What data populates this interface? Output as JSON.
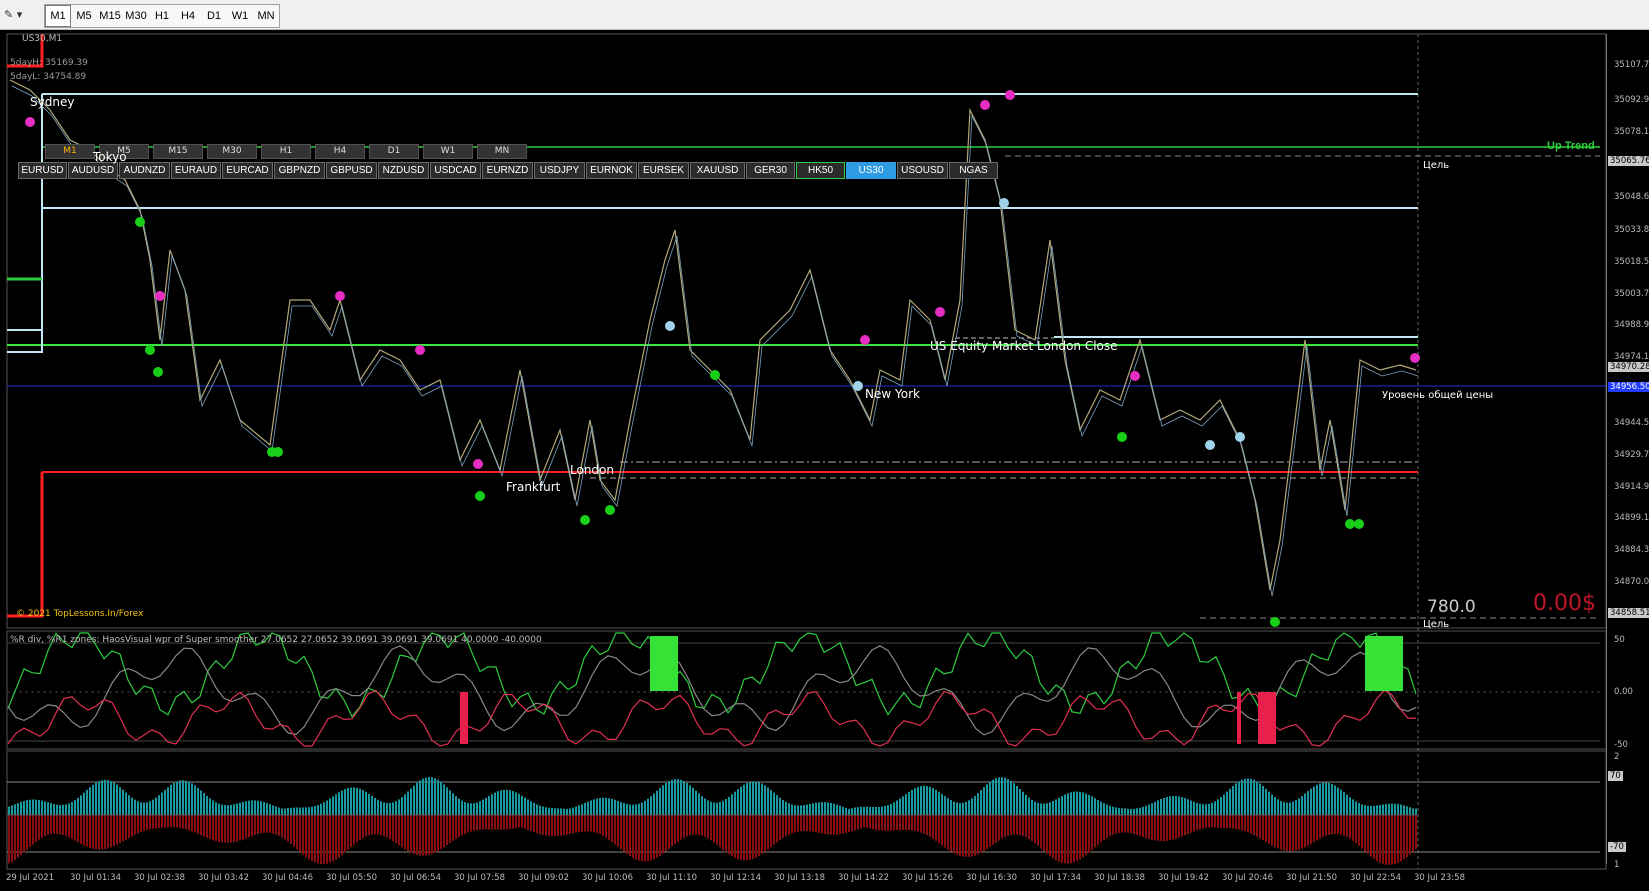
{
  "toolbar": {
    "timeframes": [
      "M1",
      "M5",
      "M15",
      "M30",
      "H1",
      "H4",
      "D1",
      "W1",
      "MN"
    ],
    "active": "M1"
  },
  "chart": {
    "title": "US30,M1",
    "info1": "5dayH: 35169.39",
    "info2": "5dayL: 34754.89",
    "copyright": "© 2021 TopLessons.In/Forex",
    "mini_timeframes": [
      "M1",
      "M5",
      "M15",
      "M30",
      "H1",
      "H4",
      "D1",
      "W1",
      "MN"
    ],
    "mini_active": "M1",
    "symbols": [
      "EURUSD",
      "AUDUSD",
      "AUDNZD",
      "EURAUD",
      "EURCAD",
      "GBPNZD",
      "GBPUSD",
      "NZDUSD",
      "USDCAD",
      "EURNZD",
      "USDJPY",
      "EURNOK",
      "EURSEK",
      "XAUUSD",
      "GER30",
      "HK50",
      "US30",
      "USOUSD",
      "NGAS"
    ],
    "selected_symbol": "US30",
    "highlighted_symbol": "HK50",
    "sessions": {
      "sydney": "Sydney",
      "tokyo": "Tokyo",
      "frankfurt": "Frankfurt",
      "london": "London",
      "new_york": "New York",
      "us_equity": "US Equity Market London Close"
    },
    "up_trend": "Up Trend",
    "target_top": "Цель",
    "target_bottom": "Цель",
    "common_level": "Уровень общей цены",
    "big_value": "780.0",
    "profit": "0.00$"
  },
  "price_axis": {
    "ticks": [
      "35107.70",
      "35092.90",
      "35078.10",
      "35065.76",
      "35048.60",
      "35033.80",
      "35018.50",
      "35003.70",
      "34988.90",
      "34974.10",
      "34970.28",
      "34959.30",
      "34944.50",
      "34929.70",
      "34914.90",
      "34899.10",
      "34884.30",
      "34870.00",
      "34858.51"
    ],
    "current": "34970.28",
    "current_blue": "34956.50"
  },
  "oscillator": {
    "label": "%R div, %R1 zones:  HaosVisual wpr of Super smoother 27.0652 27.0652 39.0691 39.0691 39.0691 40.0000 -40.0000",
    "ticks": [
      "50",
      "0.00",
      "-50"
    ]
  },
  "histogram": {
    "ticks": [
      "2",
      "70",
      "-70",
      "1"
    ]
  },
  "time_axis": [
    "29 Jul 2021",
    "30 Jul 01:34",
    "30 Jul 02:38",
    "30 Jul 03:42",
    "30 Jul 04:46",
    "30 Jul 05:50",
    "30 Jul 06:54",
    "30 Jul 07:58",
    "30 Jul 09:02",
    "30 Jul 10:06",
    "30 Jul 11:10",
    "30 Jul 12:14",
    "30 Jul 13:18",
    "30 Jul 14:22",
    "30 Jul 15:26",
    "30 Jul 16:30",
    "30 Jul 17:34",
    "30 Jul 18:38",
    "30 Jul 19:42",
    "30 Jul 20:46",
    "30 Jul 21:50",
    "30 Jul 22:54",
    "30 Jul 23:58"
  ],
  "colors": {
    "accent_green": "#2ecc40",
    "level_red": "#ff2020",
    "level_cyan": "#bfe6f7",
    "hist_teal": "#1a9aa0",
    "hist_red": "#8b0f0f",
    "selected_blue": "#2f9be3"
  }
}
